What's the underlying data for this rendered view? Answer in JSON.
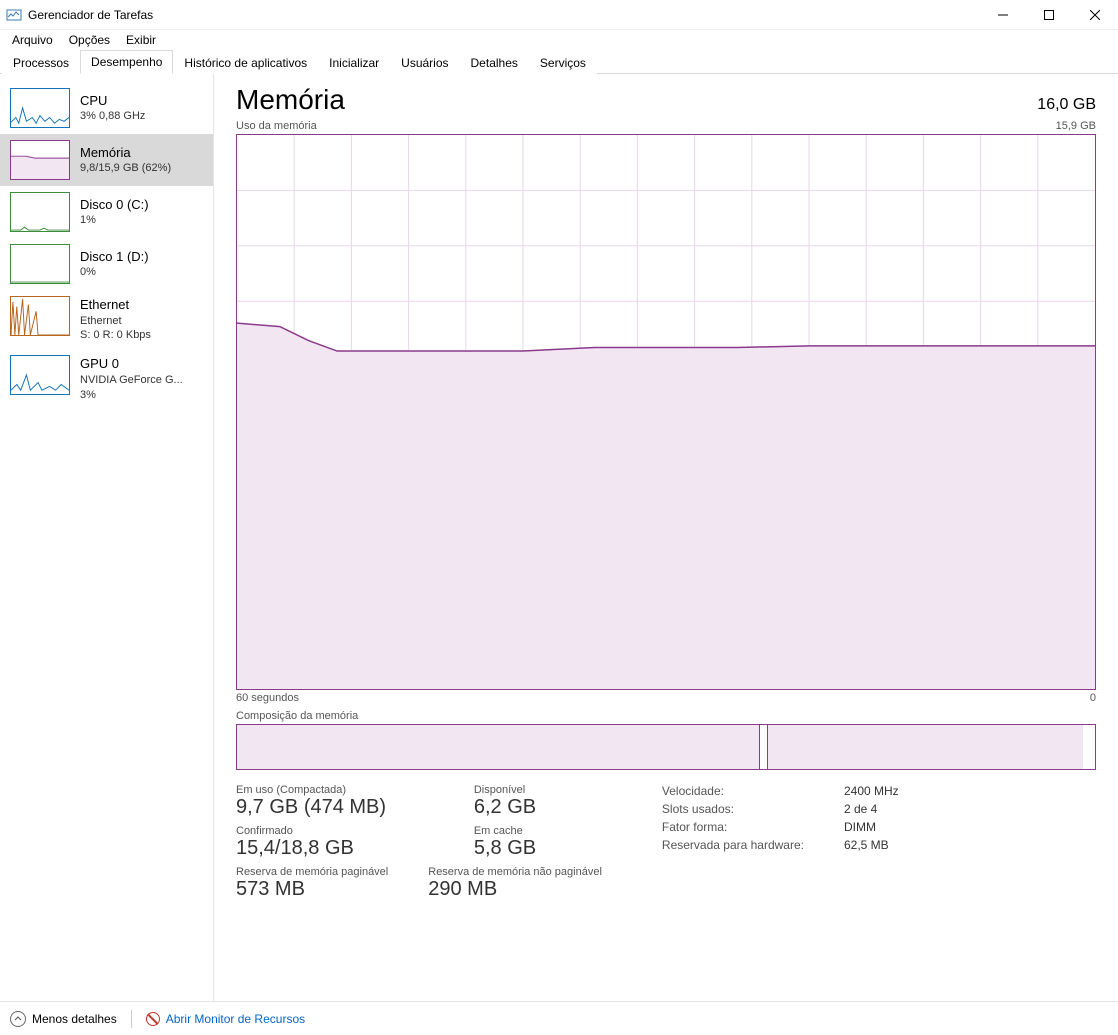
{
  "window": {
    "title": "Gerenciador de Tarefas"
  },
  "menu": {
    "file": "Arquivo",
    "options": "Opções",
    "view": "Exibir"
  },
  "tabs": {
    "processos": "Processos",
    "desempenho": "Desempenho",
    "historico": "Histórico de aplicativos",
    "inicializar": "Inicializar",
    "usuarios": "Usuários",
    "detalhes": "Detalhes",
    "servicos": "Serviços"
  },
  "sidebar": {
    "cpu": {
      "title": "CPU",
      "sub": "3% 0,88 GHz"
    },
    "memoria": {
      "title": "Memória",
      "sub": "9,8/15,9 GB (62%)"
    },
    "disco0": {
      "title": "Disco 0 (C:)",
      "sub": "1%"
    },
    "disco1": {
      "title": "Disco 1 (D:)",
      "sub": "0%"
    },
    "ethernet": {
      "title": "Ethernet",
      "sub": "Ethernet",
      "sub2": "S: 0 R: 0 Kbps"
    },
    "gpu": {
      "title": "GPU 0",
      "sub": "NVIDIA GeForce G...",
      "sub2": "3%"
    }
  },
  "detail": {
    "title": "Memória",
    "total": "16,0 GB",
    "chart_top_left": "Uso da memória",
    "chart_top_right": "15,9 GB",
    "chart_bottom_left": "60 segundos",
    "chart_bottom_right": "0",
    "comp_label": "Composição da memória"
  },
  "stats": {
    "inuse_label": "Em uso (Compactada)",
    "inuse_value": "9,7 GB (474 MB)",
    "available_label": "Disponível",
    "available_value": "6,2 GB",
    "committed_label": "Confirmado",
    "committed_value": "15,4/18,8 GB",
    "cached_label": "Em cache",
    "cached_value": "5,8 GB",
    "paged_label": "Reserva de memória paginável",
    "paged_value": "573 MB",
    "nonpaged_label": "Reserva de memória não paginável",
    "nonpaged_value": "290 MB",
    "speed_label": "Velocidade:",
    "speed_value": "2400 MHz",
    "slots_label": "Slots usados:",
    "slots_value": "2 de 4",
    "form_label": "Fator forma:",
    "form_value": "DIMM",
    "hw_label": "Reservada para hardware:",
    "hw_value": "62,5 MB"
  },
  "footer": {
    "fewer": "Menos detalhes",
    "resmon": "Abrir Monitor de Recursos"
  },
  "chart_data": {
    "type": "area",
    "title": "Uso da memória",
    "xlabel": "segundos",
    "ylabel": "GB",
    "x_range": [
      60,
      0
    ],
    "y_range": [
      0,
      15.9
    ],
    "series": [
      {
        "name": "Memória",
        "color": "#8b3a8b",
        "values": [
          {
            "t": 60,
            "v": 10.5
          },
          {
            "t": 57,
            "v": 10.4
          },
          {
            "t": 55,
            "v": 10.0
          },
          {
            "t": 53,
            "v": 9.7
          },
          {
            "t": 50,
            "v": 9.7
          },
          {
            "t": 45,
            "v": 9.7
          },
          {
            "t": 40,
            "v": 9.7
          },
          {
            "t": 35,
            "v": 9.8
          },
          {
            "t": 30,
            "v": 9.8
          },
          {
            "t": 25,
            "v": 9.8
          },
          {
            "t": 20,
            "v": 9.85
          },
          {
            "t": 15,
            "v": 9.85
          },
          {
            "t": 10,
            "v": 9.85
          },
          {
            "t": 5,
            "v": 9.85
          },
          {
            "t": 0,
            "v": 9.85
          }
        ]
      }
    ],
    "composition": {
      "in_use_gb": 9.7,
      "standby_gb": 5.8,
      "free_gb": 0.3,
      "hardware_reserved_gb": 0.0625,
      "total_gb": 15.9
    }
  }
}
